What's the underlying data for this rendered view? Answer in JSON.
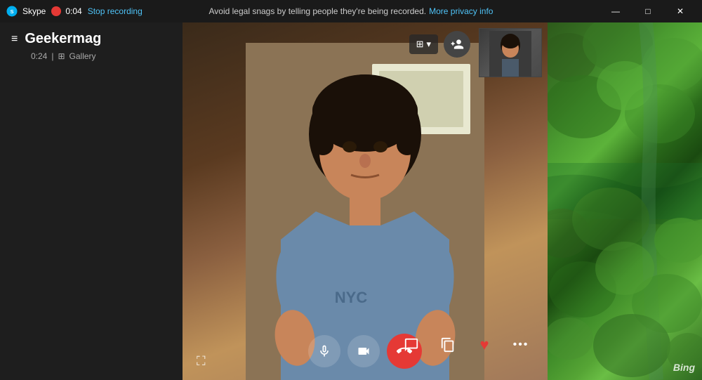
{
  "titleBar": {
    "appName": "Skype",
    "windowControls": {
      "minimize": "—",
      "maximize": "□",
      "close": "✕"
    }
  },
  "recordingBar": {
    "timer": "0:04",
    "stopRecordingLabel": "Stop recording"
  },
  "legalNotice": {
    "message": "Avoid legal snags by telling people they're being recorded.",
    "privacyLink": "More privacy info"
  },
  "sidebar": {
    "hamburgerLabel": "≡",
    "contactName": "Geekermag",
    "callDuration": "0:24",
    "galleryLabel": "Gallery"
  },
  "topControls": {
    "layoutLabel": "⊞",
    "chevronLabel": "▾",
    "addParticipantIcon": "person+"
  },
  "bottomControls": {
    "expandIcon": "⛶",
    "micIcon": "🎤",
    "videoIcon": "📷",
    "endCallIcon": "📞",
    "chatIcon": "💬",
    "windowIcon": "⧉",
    "heartIcon": "♥",
    "moreIcon": "•••"
  },
  "bingLogo": "Bing"
}
